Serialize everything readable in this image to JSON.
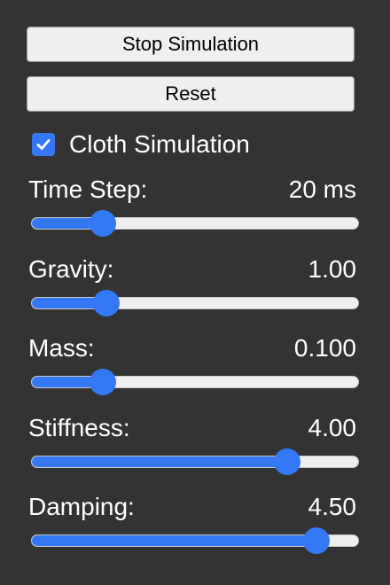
{
  "buttons": {
    "stop": "Stop Simulation",
    "reset": "Reset"
  },
  "cloth": {
    "label": "Cloth Simulation",
    "checked": true
  },
  "params": [
    {
      "key": "time_step",
      "label": "Time Step:",
      "value": "20 ms",
      "level": 0.22
    },
    {
      "key": "gravity",
      "label": "Gravity:",
      "value": "1.00",
      "level": 0.23
    },
    {
      "key": "mass",
      "label": "Mass:",
      "value": "0.100",
      "level": 0.22
    },
    {
      "key": "stiffness",
      "label": "Stiffness:",
      "value": "4.00",
      "level": 0.78
    },
    {
      "key": "damping",
      "label": "Damping:",
      "value": "4.50",
      "level": 0.87
    }
  ],
  "colors": {
    "background": "#333333",
    "accent": "#3478f6",
    "track": "#efefef",
    "button_bg": "#efefef"
  }
}
